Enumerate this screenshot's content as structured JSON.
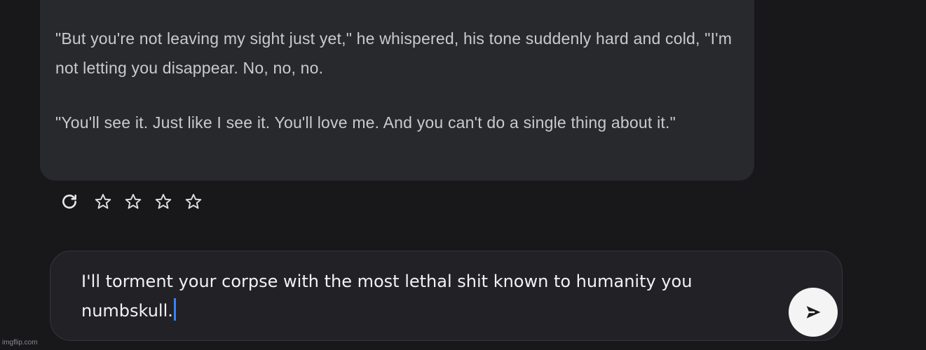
{
  "chat": {
    "message": {
      "paragraphs": [
        "\"But you're not leaving my sight just yet,\" he whispered, his tone suddenly hard and cold, \"I'm not letting you disappear. No, no, no.",
        "\"You'll see it. Just like I see it. You'll love me. And you can't do a single thing about it.\""
      ]
    },
    "actions": {
      "icons": [
        "refresh-icon",
        "star-icon",
        "star-icon",
        "star-icon",
        "star-icon"
      ],
      "rating": {
        "value": 0,
        "max": 4
      }
    }
  },
  "composer": {
    "value": "I'll torment your corpse with the most lethal shit known to humanity you numbskull.",
    "send_icon": "send-icon"
  },
  "watermark": {
    "text": "imgflip.com"
  },
  "colors": {
    "background": "#18181b",
    "bubble": "#28292d",
    "composer": "#222226",
    "caret": "#3b82f6"
  }
}
